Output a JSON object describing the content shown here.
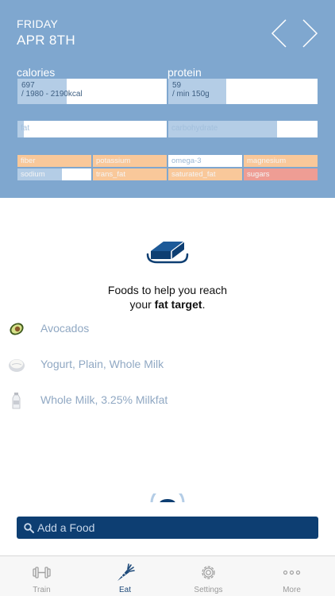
{
  "header": {
    "day": "FRIDAY",
    "date": "APR 8TH",
    "prev_icon": "chevron-left-icon",
    "next_icon": "chevron-right-icon"
  },
  "macros": {
    "calories": {
      "label": "calories",
      "line1": "697",
      "line2": "/ 1980 - 2190kcal",
      "progress": 0.33
    },
    "protein": {
      "label": "protein",
      "line1": "59",
      "line2": "/ min 150g",
      "progress": 0.39
    },
    "fat": {
      "label": "fat",
      "progress": 0.04
    },
    "carbohydrate": {
      "label": "carbohydrate",
      "progress": 0.73
    }
  },
  "micros": {
    "fiber": {
      "label": "fiber",
      "progress": 1.0,
      "color": "#f9c89a"
    },
    "potassium": {
      "label": "potassium",
      "progress": 1.0,
      "color": "#f9c89a"
    },
    "omega3": {
      "label": "omega-3",
      "progress": 0.0,
      "color": "#b4cde6"
    },
    "magnesium": {
      "label": "magnesium",
      "progress": 1.0,
      "color": "#f9c89a"
    },
    "sodium": {
      "label": "sodium",
      "progress": 0.6,
      "color": "#b4cde6"
    },
    "trans_fat": {
      "label": "trans_fat",
      "progress": 1.0,
      "color": "#f9c89a"
    },
    "saturated_fat": {
      "label": "saturated_fat",
      "progress": 1.0,
      "color": "#f9c89a"
    },
    "sugars": {
      "label": "sugars",
      "progress": 1.0,
      "color": "#ee9d94"
    }
  },
  "recommendation": {
    "icon": "butter-icon",
    "line1": "Foods to help you reach",
    "line2_prefix": "your ",
    "line2_bold": "fat target",
    "line2_suffix": "."
  },
  "foods": [
    {
      "name": "Avocados",
      "icon": "avocado-icon"
    },
    {
      "name": "Yogurt, Plain, Whole Milk",
      "icon": "yogurt-icon"
    },
    {
      "name": "Whole Milk, 3.25% Milkfat",
      "icon": "milk-bottle-icon"
    }
  ],
  "search": {
    "placeholder": "Add a Food",
    "icon": "search-icon"
  },
  "tabs": [
    {
      "label": "Train",
      "icon": "dumbbell-icon",
      "active": false
    },
    {
      "label": "Eat",
      "icon": "carrot-icon",
      "active": true
    },
    {
      "label": "Settings",
      "icon": "gear-icon",
      "active": false
    },
    {
      "label": "More",
      "icon": "ellipsis-icon",
      "active": false
    }
  ],
  "colors": {
    "header_bg": "#7fa7cf",
    "accent": "#0d3e72",
    "progress_blue": "#b4cde6",
    "over_orange": "#f9c89a",
    "over_red": "#ee9d94"
  }
}
